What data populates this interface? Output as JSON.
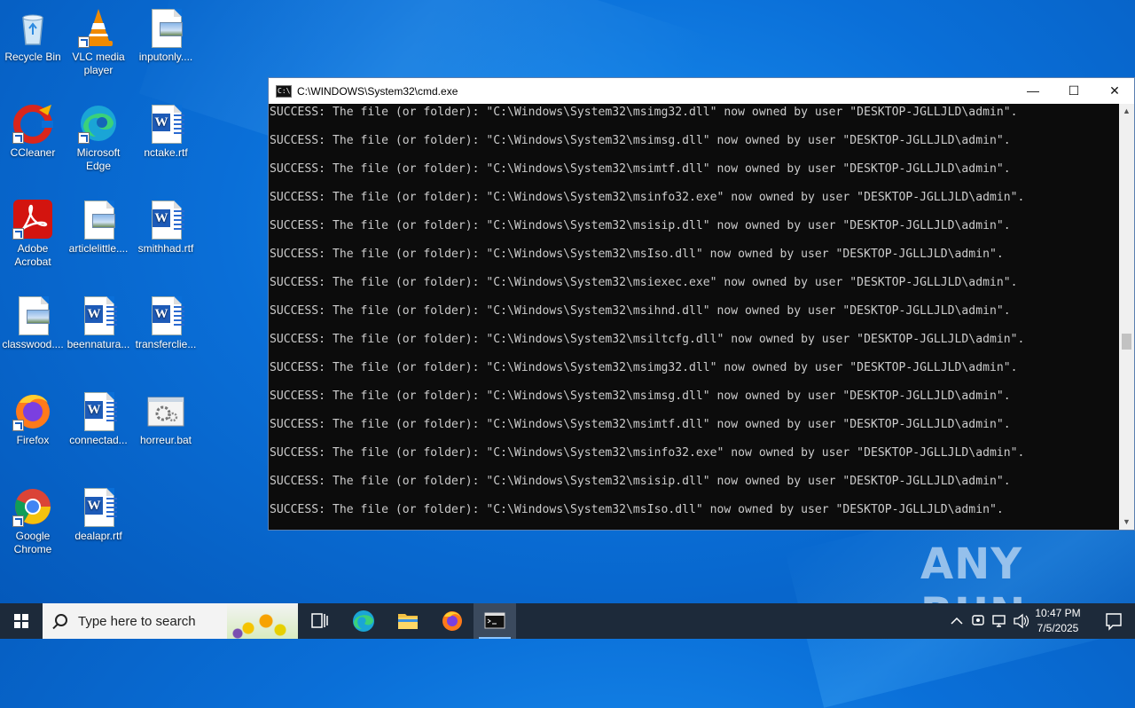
{
  "desktop": {
    "icons": [
      {
        "label": "Recycle Bin",
        "type": "recycle-bin"
      },
      {
        "label": "VLC media player",
        "type": "vlc"
      },
      {
        "label": "inputonly....",
        "type": "image-file"
      },
      {
        "label": "CCleaner",
        "type": "ccleaner"
      },
      {
        "label": "Microsoft Edge",
        "type": "edge"
      },
      {
        "label": "nctake.rtf",
        "type": "word-file"
      },
      {
        "label": "Adobe Acrobat",
        "type": "acrobat"
      },
      {
        "label": "articlelittle....",
        "type": "image-file"
      },
      {
        "label": "smithhad.rtf",
        "type": "word-file"
      },
      {
        "label": "classwood....",
        "type": "image-file"
      },
      {
        "label": "beennatura...",
        "type": "word-file"
      },
      {
        "label": "transferclie...",
        "type": "word-file"
      },
      {
        "label": "Firefox",
        "type": "firefox"
      },
      {
        "label": "connectad...",
        "type": "word-file"
      },
      {
        "label": "horreur.bat",
        "type": "bat-file"
      },
      {
        "label": "Google Chrome",
        "type": "chrome"
      },
      {
        "label": "dealapr.rtf",
        "type": "word-file"
      }
    ]
  },
  "cmd_window": {
    "title": "C:\\WINDOWS\\System32\\cmd.exe",
    "icon_glyph": "C:\\",
    "minimize_glyph": "—",
    "maximize_glyph": "☐",
    "close_glyph": "✕",
    "lines": [
      "SUCCESS: The file (or folder): \"C:\\Windows\\System32\\msimg32.dll\" now owned by user \"DESKTOP-JGLLJLD\\admin\".",
      "SUCCESS: The file (or folder): \"C:\\Windows\\System32\\msimsg.dll\" now owned by user \"DESKTOP-JGLLJLD\\admin\".",
      "SUCCESS: The file (or folder): \"C:\\Windows\\System32\\msimtf.dll\" now owned by user \"DESKTOP-JGLLJLD\\admin\".",
      "SUCCESS: The file (or folder): \"C:\\Windows\\System32\\msinfo32.exe\" now owned by user \"DESKTOP-JGLLJLD\\admin\".",
      "SUCCESS: The file (or folder): \"C:\\Windows\\System32\\msisip.dll\" now owned by user \"DESKTOP-JGLLJLD\\admin\".",
      "SUCCESS: The file (or folder): \"C:\\Windows\\System32\\msIso.dll\" now owned by user \"DESKTOP-JGLLJLD\\admin\".",
      "SUCCESS: The file (or folder): \"C:\\Windows\\System32\\msiexec.exe\" now owned by user \"DESKTOP-JGLLJLD\\admin\".",
      "SUCCESS: The file (or folder): \"C:\\Windows\\System32\\msihnd.dll\" now owned by user \"DESKTOP-JGLLJLD\\admin\".",
      "SUCCESS: The file (or folder): \"C:\\Windows\\System32\\msiltcfg.dll\" now owned by user \"DESKTOP-JGLLJLD\\admin\".",
      "SUCCESS: The file (or folder): \"C:\\Windows\\System32\\msimg32.dll\" now owned by user \"DESKTOP-JGLLJLD\\admin\".",
      "SUCCESS: The file (or folder): \"C:\\Windows\\System32\\msimsg.dll\" now owned by user \"DESKTOP-JGLLJLD\\admin\".",
      "SUCCESS: The file (or folder): \"C:\\Windows\\System32\\msimtf.dll\" now owned by user \"DESKTOP-JGLLJLD\\admin\".",
      "SUCCESS: The file (or folder): \"C:\\Windows\\System32\\msinfo32.exe\" now owned by user \"DESKTOP-JGLLJLD\\admin\".",
      "SUCCESS: The file (or folder): \"C:\\Windows\\System32\\msisip.dll\" now owned by user \"DESKTOP-JGLLJLD\\admin\".",
      "SUCCESS: The file (or folder): \"C:\\Windows\\System32\\msIso.dll\" now owned by user \"DESKTOP-JGLLJLD\\admin\"."
    ],
    "text_color": "#cccccc",
    "background_color": "#0c0c0c"
  },
  "watermark": {
    "text": "ANY RUN"
  },
  "taskbar": {
    "search_placeholder": "Type here to search",
    "pinned": [
      "task-view-icon",
      "edge-icon",
      "file-explorer-icon",
      "firefox-icon",
      "cmd-icon"
    ],
    "active": "cmd-icon",
    "clock_time": "10:47 PM",
    "clock_date": "7/5/2025",
    "tray_chevron": "^",
    "background_color": "#1d2a3a"
  }
}
